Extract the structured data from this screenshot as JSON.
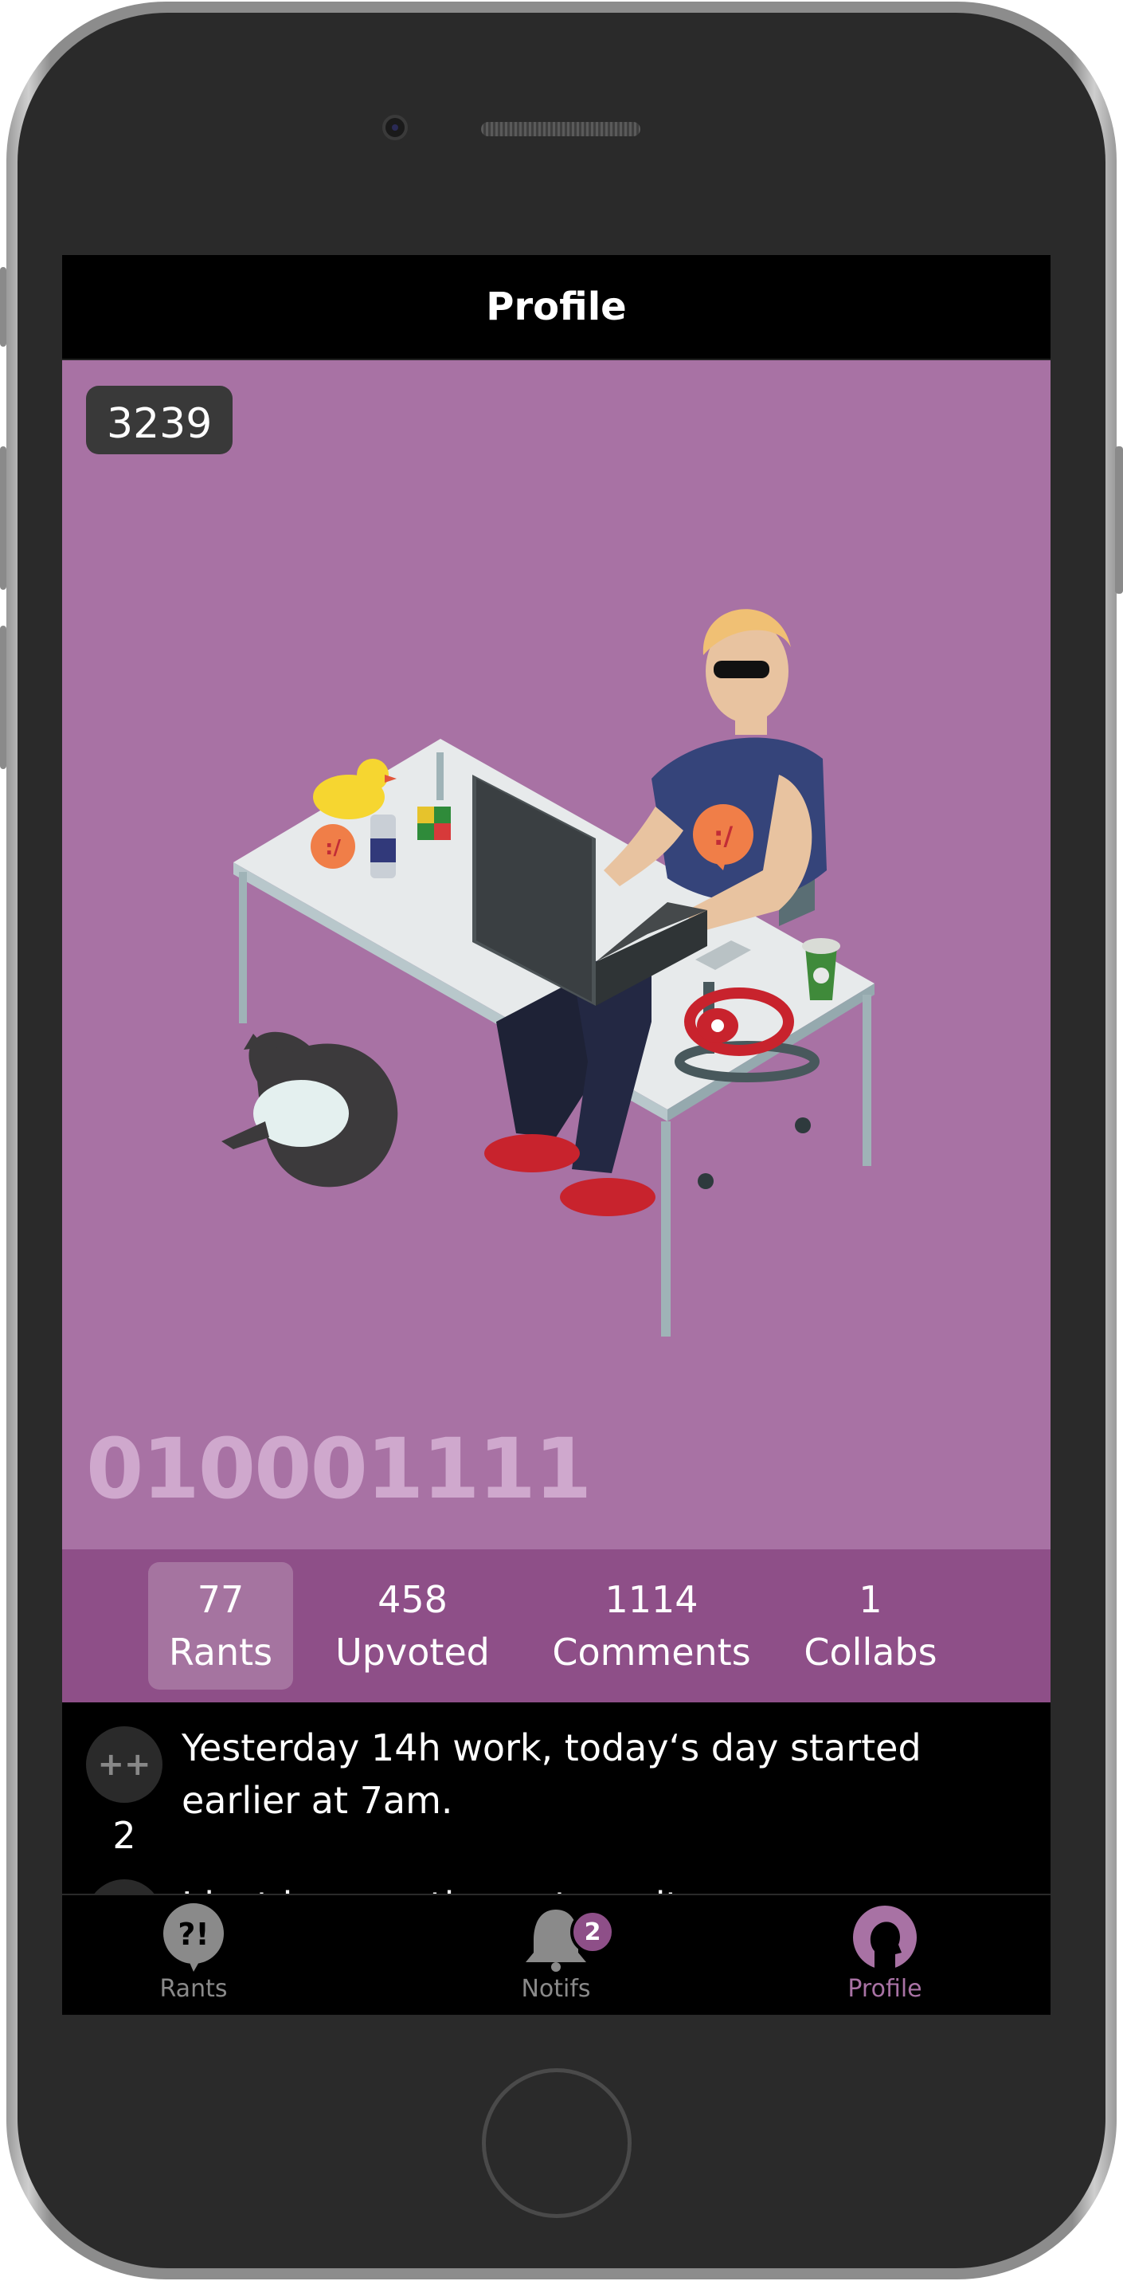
{
  "header": {
    "title": "Profile"
  },
  "profile": {
    "score": "3239",
    "username": "010001111",
    "background_color": "#a872a4"
  },
  "stats": [
    {
      "value": "77",
      "label": "Rants",
      "active": true
    },
    {
      "value": "458",
      "label": "Upvoted",
      "active": false
    },
    {
      "value": "1114",
      "label": "Comments",
      "active": false
    },
    {
      "value": "1",
      "label": "Collabs",
      "active": false
    }
  ],
  "feed": {
    "items": [
      {
        "vote_label": "++",
        "score": "2",
        "text": "Yesterday 14h work, today‘s day started earlier at 7am."
      },
      {
        "text": "I just have patience to wait…"
      }
    ]
  },
  "tabs": [
    {
      "label": "Rants",
      "icon": "rants-bubble-icon",
      "active": false
    },
    {
      "label": "Notifs",
      "icon": "bell-icon",
      "badge": "2",
      "active": false
    },
    {
      "label": "Profile",
      "icon": "profile-head-icon",
      "active": true
    }
  ],
  "colors": {
    "accent": "#8e4f88",
    "accent_light": "#a872a4",
    "background": "#000000"
  }
}
